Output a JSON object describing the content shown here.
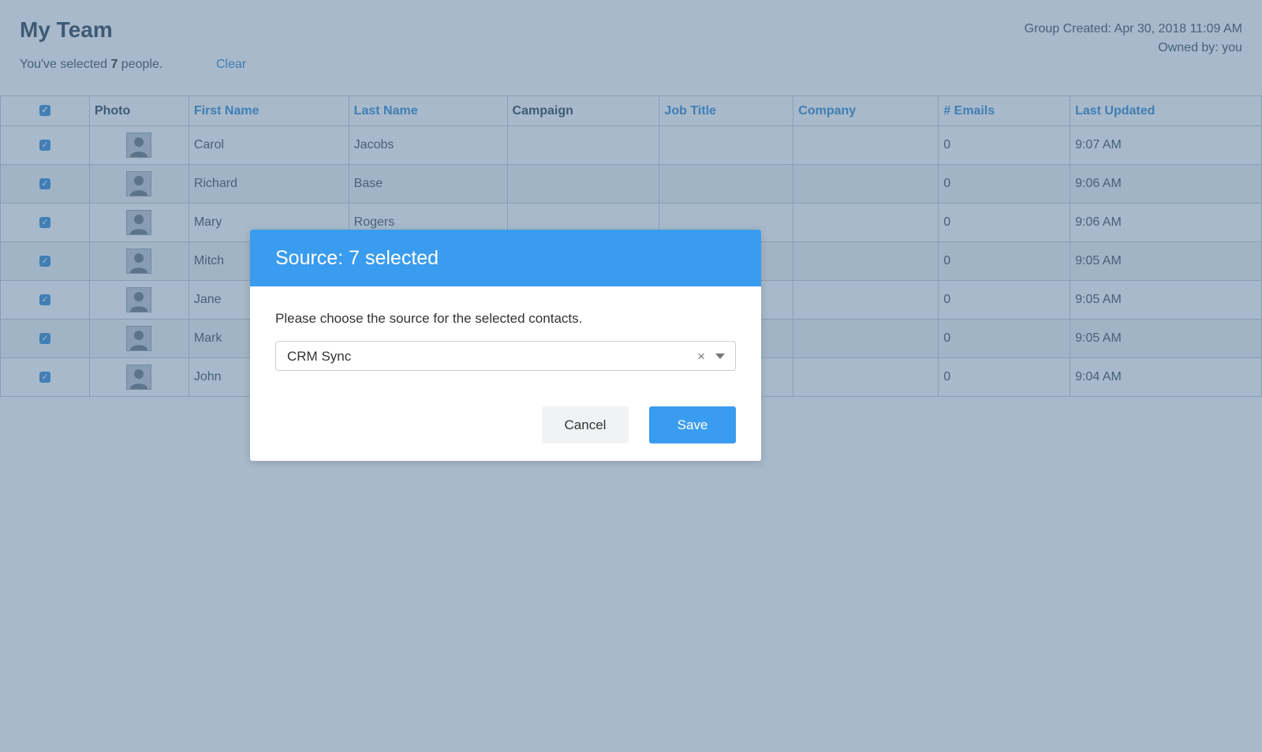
{
  "page": {
    "title": "My Team",
    "selection_prefix": "You've selected ",
    "selection_count": "7",
    "selection_suffix": " people.",
    "clear_label": "Clear",
    "group_created": "Group Created: Apr 30, 2018 11:09 AM",
    "owned_by": "Owned by: you"
  },
  "table": {
    "headers": {
      "photo": "Photo",
      "first_name": "First Name",
      "last_name": "Last Name",
      "campaign": "Campaign",
      "job_title": "Job Title",
      "company": "Company",
      "emails": "# Emails",
      "last_updated": "Last Updated"
    },
    "rows": [
      {
        "first_name": "Carol",
        "last_name": "Jacobs",
        "emails": "0",
        "last_updated": "9:07 AM"
      },
      {
        "first_name": "Richard",
        "last_name": "Base",
        "emails": "0",
        "last_updated": "9:06 AM"
      },
      {
        "first_name": "Mary",
        "last_name": "Rogers",
        "emails": "0",
        "last_updated": "9:06 AM"
      },
      {
        "first_name": "Mitch",
        "last_name": "",
        "emails": "0",
        "last_updated": "9:05 AM"
      },
      {
        "first_name": "Jane",
        "last_name": "",
        "emails": "0",
        "last_updated": "9:05 AM"
      },
      {
        "first_name": "Mark",
        "last_name": "",
        "emails": "0",
        "last_updated": "9:05 AM"
      },
      {
        "first_name": "John",
        "last_name": "",
        "emails": "0",
        "last_updated": "9:04 AM"
      }
    ]
  },
  "modal": {
    "title": "Source: 7 selected",
    "prompt": "Please choose the source for the selected contacts.",
    "select_value": "CRM Sync",
    "clear_icon": "×",
    "cancel_label": "Cancel",
    "save_label": "Save"
  },
  "colors": {
    "accent": "#3a9cee",
    "link": "#3b8fd6",
    "overlay": "#476d91"
  },
  "icons": {
    "checkbox": "checkbox-checked-icon",
    "avatar": "person-silhouette-icon",
    "clear": "clear-x-icon",
    "dropdown": "chevron-down-icon"
  }
}
